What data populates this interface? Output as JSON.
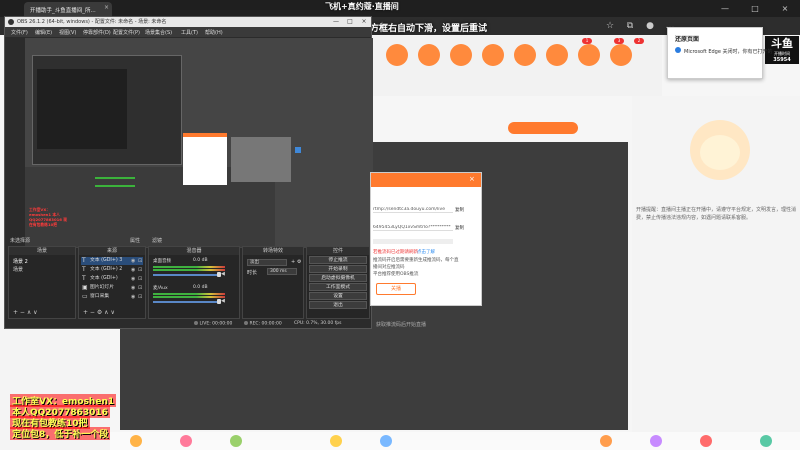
{
  "browser": {
    "tab_title": "开播助手_斗鱼直播间_所...",
    "tab_close": "×",
    "overlay_message": "后播方框右自动下滑，设置后重试",
    "top_stream_text": "飞机+真约蔻·直播间",
    "window_controls": [
      "—",
      "□",
      "×"
    ]
  },
  "edge_popup": {
    "title": "还原页面",
    "body": "Microsoft Edge 关闭时，你有已打开的"
  },
  "logo": {
    "main": "斗鱼",
    "sub": "开播时间",
    "number": "35954"
  },
  "site_nav": {
    "badges": [
      "1",
      "3",
      "2"
    ]
  },
  "player": {
    "caption": "获取推流码后开始直播"
  },
  "chat": {
    "text": "开播提醒：直播间主播正在开播中，请遵守平台规定，文明发言，理性消费，禁止传播违法违规内容，如遇问题请联系客服。"
  },
  "watermark": {
    "line1": "工作室VX：emoshen1",
    "line2": "本人QQ2077863016",
    "line3": "现在有包教练10把",
    "line4": "定位包8，低于补一个段"
  },
  "obs": {
    "title": "OBS 26.1.2 (64-bit, windows) - 配置文件: 未命名 - 场景: 未命名",
    "menu": [
      "文件(F)",
      "编辑(E)",
      "视图(V)",
      "停靠部件(D)",
      "配置文件(P)",
      "场景集合(S)",
      "工具(T)",
      "帮助(H)"
    ],
    "window_controls": [
      "—",
      "□",
      "×"
    ],
    "red_note": "工作室VX：emoshen1 本人QQ2077863016 现在有包教练10把",
    "scene_row": {
      "label": "未选择源",
      "properties": "属性",
      "filters": "滤镜"
    },
    "docks": {
      "scenes": {
        "title": "场景",
        "items": [
          "场景 2",
          "场景"
        ]
      },
      "sources": {
        "title": "来源",
        "items": [
          {
            "label": "文本 (GDI+) 3",
            "icon": "text-icon"
          },
          {
            "label": "文本 (GDI+) 2",
            "icon": "text-icon"
          },
          {
            "label": "文本 (GDI+)",
            "icon": "text-icon"
          },
          {
            "label": "图片幻灯片",
            "icon": "image-icon"
          },
          {
            "label": "窗口采集",
            "icon": "window-icon"
          }
        ]
      },
      "mixer": {
        "title": "混音器",
        "channels": [
          {
            "name": "桌面音频",
            "db": "0.0 dB"
          },
          {
            "name": "麦/Aux",
            "db": "0.0 dB"
          }
        ]
      },
      "transitions": {
        "title": "转场特效",
        "type": "淡出",
        "duration_label": "时长",
        "duration": "300 ms"
      },
      "controls": {
        "title": "控件",
        "buttons": [
          "停止推流",
          "开始录制",
          "启动虚拟摄像机",
          "工作室模式",
          "设置",
          "退出"
        ]
      }
    },
    "status": {
      "live": "LIVE: 00:00:00",
      "rec": "REC: 00:00:00",
      "cpu": "CPU: 0.7%, 30.00 fps"
    }
  },
  "dialog": {
    "url": "rtmp://sendtc3a.douyu.com/live",
    "key": "6495453LyQQ1xvSmtrlo?*********",
    "copy": "复制",
    "warning": "若推流码已过期请刷新",
    "link": "点击了解",
    "lines": [
      "推流码开启后需要重新生成推流码，每个直",
      "播间对应推流码",
      "平台推荐使用OBS推流"
    ],
    "button": "关播"
  }
}
